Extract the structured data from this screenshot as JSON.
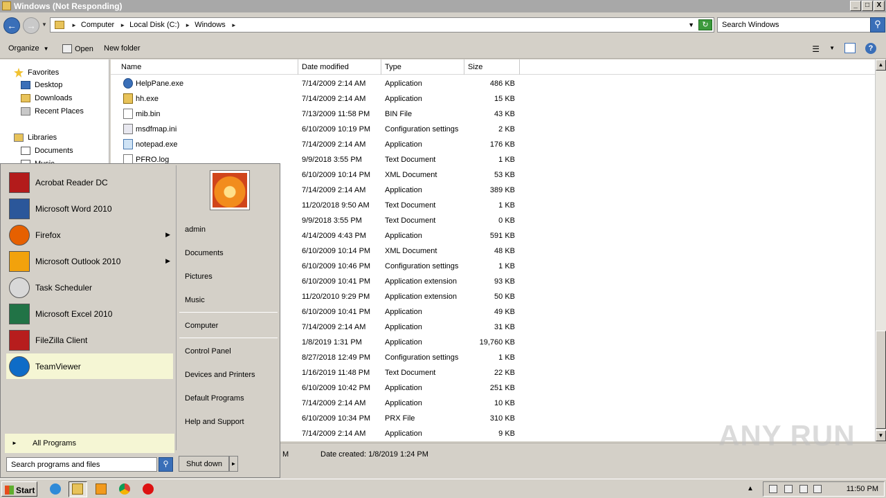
{
  "window": {
    "title": "Windows (Not Responding)",
    "min": "_",
    "max": "□",
    "close": "X"
  },
  "address": {
    "crumbs": [
      "Computer",
      "Local Disk (C:)",
      "Windows"
    ],
    "search_placeholder": "Search Windows"
  },
  "toolbar": {
    "organize": "Organize",
    "open": "Open",
    "new_folder": "New folder"
  },
  "nav": {
    "favorites": "Favorites",
    "desktop": "Desktop",
    "downloads": "Downloads",
    "recent": "Recent Places",
    "libraries": "Libraries",
    "documents": "Documents",
    "music_partial": "Music"
  },
  "columns": {
    "name": "Name",
    "date": "Date modified",
    "type": "Type",
    "size": "Size"
  },
  "files": [
    {
      "name": "HelpPane.exe",
      "date": "7/14/2009 2:14 AM",
      "type": "Application",
      "size": "486 KB",
      "icon": "help-app"
    },
    {
      "name": "hh.exe",
      "date": "7/14/2009 2:14 AM",
      "type": "Application",
      "size": "15 KB",
      "icon": "help-file"
    },
    {
      "name": "mib.bin",
      "date": "7/13/2009 11:58 PM",
      "type": "BIN File",
      "size": "43 KB",
      "icon": "generic-file"
    },
    {
      "name": "msdfmap.ini",
      "date": "6/10/2009 10:19 PM",
      "type": "Configuration settings",
      "size": "2 KB",
      "icon": "ini-file"
    },
    {
      "name": "notepad.exe",
      "date": "7/14/2009 2:14 AM",
      "type": "Application",
      "size": "176 KB",
      "icon": "notepad"
    },
    {
      "name": "PFRO.log",
      "date": "9/9/2018 3:55 PM",
      "type": "Text Document",
      "size": "1 KB",
      "icon": "generic-file"
    },
    {
      "name": "",
      "date": "6/10/2009 10:14 PM",
      "type": "XML Document",
      "size": "53 KB"
    },
    {
      "name": "",
      "date": "7/14/2009 2:14 AM",
      "type": "Application",
      "size": "389 KB"
    },
    {
      "name": "",
      "date": "11/20/2018 9:50 AM",
      "type": "Text Document",
      "size": "1 KB"
    },
    {
      "name": "",
      "date": "9/9/2018 3:55 PM",
      "type": "Text Document",
      "size": "0 KB"
    },
    {
      "name": "",
      "date": "4/14/2009 4:43 PM",
      "type": "Application",
      "size": "591 KB"
    },
    {
      "name": "",
      "date": "6/10/2009 10:14 PM",
      "type": "XML Document",
      "size": "48 KB"
    },
    {
      "name": "",
      "date": "6/10/2009 10:46 PM",
      "type": "Configuration settings",
      "size": "1 KB"
    },
    {
      "name": "",
      "date": "6/10/2009 10:41 PM",
      "type": "Application extension",
      "size": "93 KB"
    },
    {
      "name": "",
      "date": "11/20/2010 9:29 PM",
      "type": "Application extension",
      "size": "50 KB"
    },
    {
      "name": "",
      "date": "6/10/2009 10:41 PM",
      "type": "Application",
      "size": "49 KB"
    },
    {
      "name": "",
      "date": "7/14/2009 2:14 AM",
      "type": "Application",
      "size": "31 KB"
    },
    {
      "name": "",
      "date": "1/8/2019 1:31 PM",
      "type": "Application",
      "size": "19,760 KB"
    },
    {
      "name": "",
      "date": "8/27/2018 12:49 PM",
      "type": "Configuration settings",
      "size": "1 KB"
    },
    {
      "name": "",
      "date": "1/16/2019 11:48 PM",
      "type": "Text Document",
      "size": "22 KB"
    },
    {
      "name": "",
      "date": "6/10/2009 10:42 PM",
      "type": "Application",
      "size": "251 KB"
    },
    {
      "name": "",
      "date": "7/14/2009 2:14 AM",
      "type": "Application",
      "size": "10 KB"
    },
    {
      "name": "",
      "date": "6/10/2009 10:34 PM",
      "type": "PRX File",
      "size": "310 KB"
    },
    {
      "name": "",
      "date": "7/14/2009 2:14 AM",
      "type": "Application",
      "size": "9 KB"
    }
  ],
  "details": {
    "partial": "M",
    "created": "Date created: 1/8/2019 1:24 PM"
  },
  "watermark": "ANY RUN",
  "startmenu": {
    "programs": [
      {
        "label": "Acrobat Reader DC",
        "submenu": false,
        "highlight": false
      },
      {
        "label": "Microsoft Word 2010",
        "submenu": false,
        "highlight": false
      },
      {
        "label": "Firefox",
        "submenu": true,
        "highlight": false
      },
      {
        "label": "Microsoft Outlook 2010",
        "submenu": true,
        "highlight": false
      },
      {
        "label": "Task Scheduler",
        "submenu": false,
        "highlight": false
      },
      {
        "label": "Microsoft Excel 2010",
        "submenu": false,
        "highlight": false
      },
      {
        "label": "FileZilla Client",
        "submenu": false,
        "highlight": false
      },
      {
        "label": "TeamViewer",
        "submenu": false,
        "highlight": true
      }
    ],
    "all_programs": "All Programs",
    "search_placeholder": "Search programs and files",
    "right": [
      "admin",
      "Documents",
      "Pictures",
      "Music",
      "Computer",
      "Control Panel",
      "Devices and Printers",
      "Default Programs",
      "Help and Support"
    ],
    "shutdown": "Shut down"
  },
  "taskbar": {
    "start": "Start",
    "clock": "11:50 PM"
  }
}
